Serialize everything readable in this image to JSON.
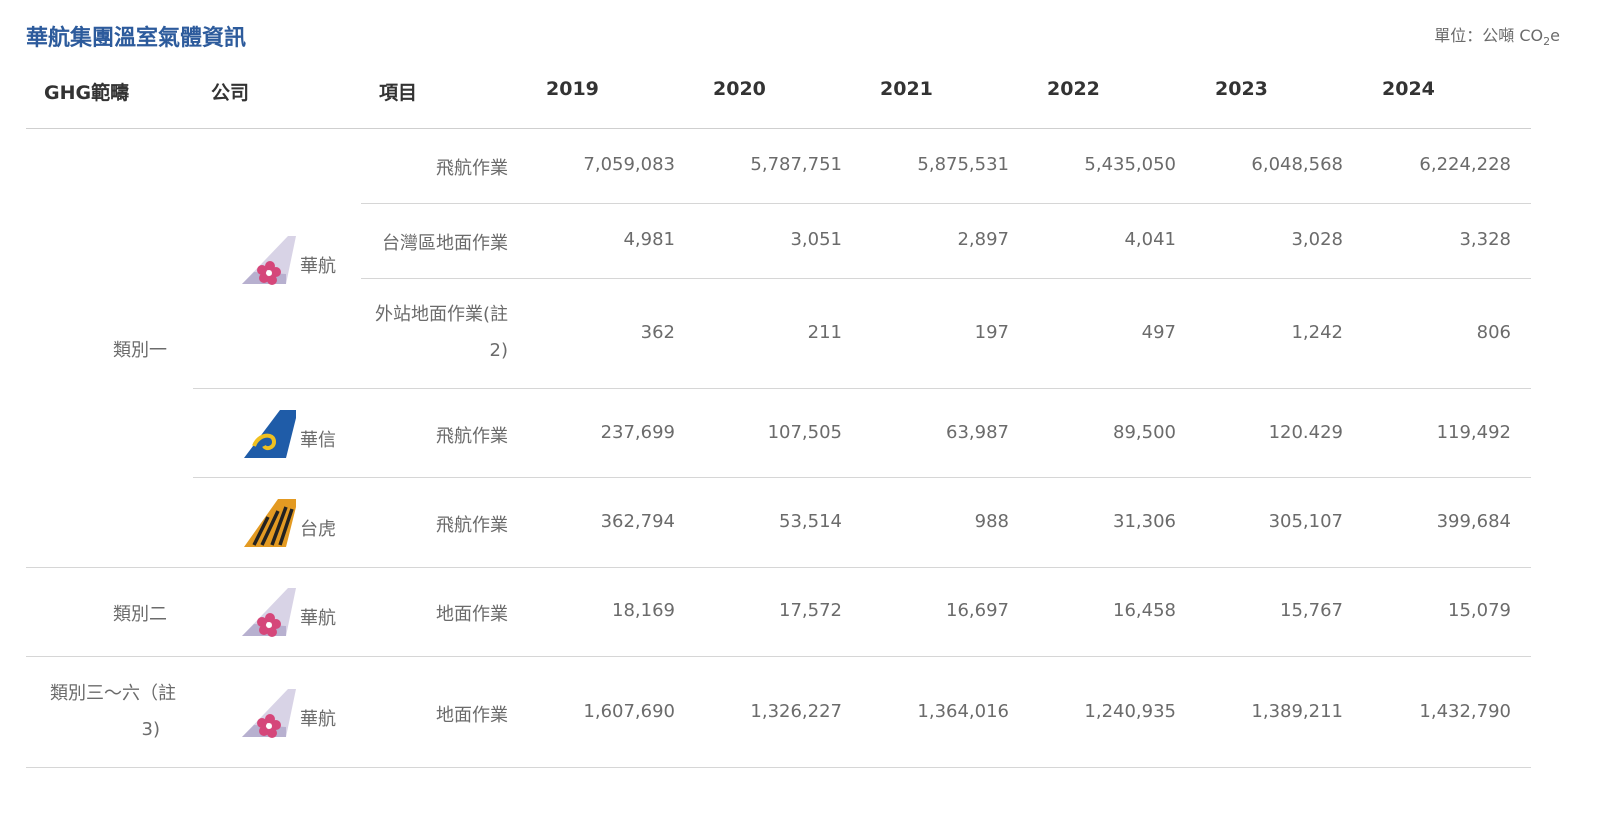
{
  "title": "華航集團溫室氣體資訊",
  "unit": {
    "prefix": "單位：公噸 CO",
    "sub": "2",
    "suffix": "e"
  },
  "headers": {
    "scope": "GHG範疇",
    "company": "公司",
    "item": "項目",
    "years": [
      "2019",
      "2020",
      "2021",
      "2022",
      "2023",
      "2024"
    ]
  },
  "scopes": {
    "cat1": "類別一",
    "cat2": "類別二",
    "cat3_line1": "類別三～六（註",
    "cat3_line2": "3)"
  },
  "companies": {
    "ci": "華航",
    "ae": "華信",
    "it": "台虎"
  },
  "items": {
    "flight_ops": "飛航作業",
    "taiwan_ground": "台灣區地面作業",
    "outstation_line1": "外站地面作業(註",
    "outstation_line2": "2)",
    "ground_ops": "地面作業"
  },
  "rows": [
    [
      "7,059,083",
      "5,787,751",
      "5,875,531",
      "5,435,050",
      "6,048,568",
      "6,224,228"
    ],
    [
      "4,981",
      "3,051",
      "2,897",
      "4,041",
      "3,028",
      "3,328"
    ],
    [
      "362",
      "211",
      "197",
      "497",
      "1,242",
      "806"
    ],
    [
      "237,699",
      "107,505",
      "63,987",
      "89,500",
      "120.429",
      "119,492"
    ],
    [
      "362,794",
      "53,514",
      "988",
      "31,306",
      "305,107",
      "399,684"
    ],
    [
      "18,169",
      "17,572",
      "16,697",
      "16,458",
      "15,767",
      "15,079"
    ],
    [
      "1,607,690",
      "1,326,227",
      "1,364,016",
      "1,240,935",
      "1,389,211",
      "1,432,790"
    ]
  ],
  "colors": {
    "title": "#2d5b9c",
    "china_airlines_pink": "#d5477a",
    "mandarin_blue": "#1f5ca8",
    "mandarin_yellow": "#f0c020",
    "tigerair_orange": "#e39a22"
  },
  "icons": [
    "china-airlines-tail-logo-icon",
    "mandarin-airlines-tail-logo-icon",
    "tigerair-tail-logo-icon"
  ]
}
